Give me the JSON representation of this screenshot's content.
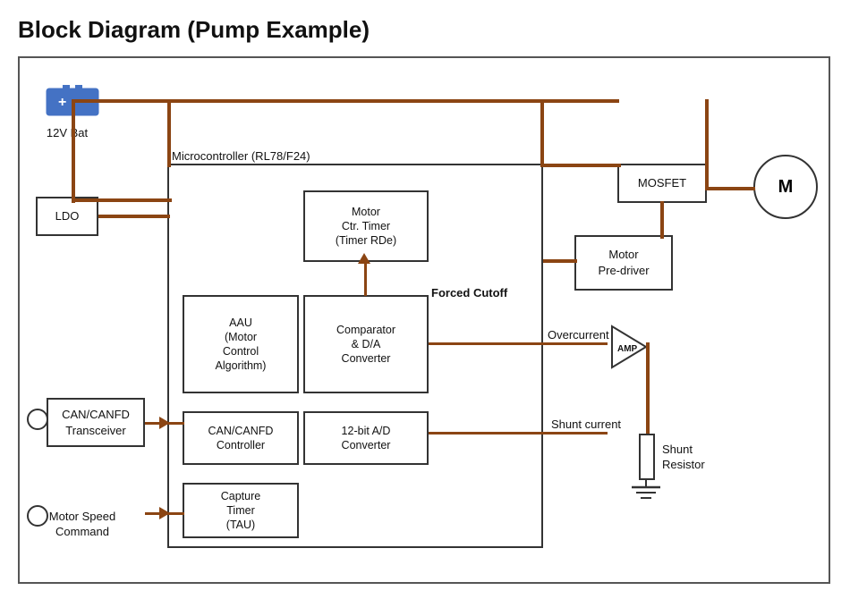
{
  "title": "Block Diagram (Pump Example)",
  "diagram": {
    "battery_label": "12V Bat",
    "ldo_label": "LDO",
    "mc_label": "Microcontroller (RL78/F24)",
    "mosfet_label": "MOSFET",
    "motor_label": "M",
    "motor_pretimer_label": "Motor\nCtr. Timer\n(Timer RDe)",
    "motor_predriver_label": "Motor\nPre-driver",
    "aau_label": "AAU\n(Motor\nControl\nAlgorithm)",
    "forced_cutoff_label": "Forced\nCutoff",
    "comparator_label": "Comparator\n& D/A\nConverter",
    "can_canfd_transceiver_label": "CAN/CANFD\nTransceiver",
    "can_canfd_controller_label": "CAN/CANFD\nController",
    "bit12_adc_label": "12-bit A/D\nConverter",
    "capture_timer_label": "Capture\nTimer\n(TAU)",
    "overcurrent_label": "Overcurrent",
    "shunt_current_label": "Shunt\ncurrent",
    "amp_label": "AMP",
    "shunt_resistor_label": "Shunt\nResistor",
    "motor_speed_cmd_label": "Motor Speed\nCommand"
  }
}
